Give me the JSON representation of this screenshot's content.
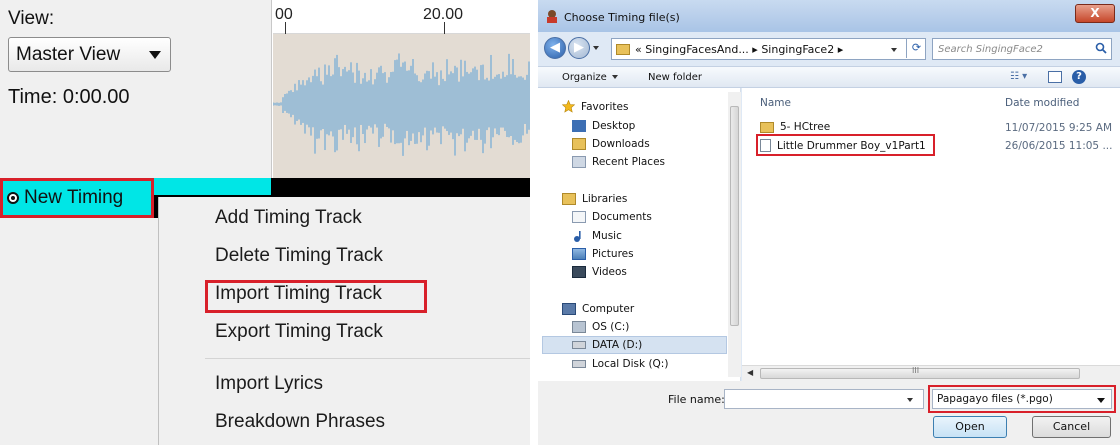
{
  "left_app": {
    "view_label": "View:",
    "view_select_value": "Master View",
    "time_label": "Time: 0:00.00",
    "ruler": {
      "tick_left": "00",
      "tick_right": "20.00"
    },
    "track_name": "New Timing",
    "context_menu": [
      {
        "label": "Add Timing Track"
      },
      {
        "label": "Delete Timing Track"
      },
      {
        "label": "Import Timing Track"
      },
      {
        "label": "Export Timing Track"
      },
      {
        "label": "Import Lyrics"
      },
      {
        "label": "Breakdown Phrases"
      }
    ],
    "highlight_color": "#d8202a",
    "track_color": "#00e6e6",
    "wave_color": "#8cb6d6"
  },
  "dialog": {
    "title": "Choose Timing file(s)",
    "close_label": "X",
    "address_path": "« SingingFacesAnd... ▸ SingingFace2 ▸",
    "search_placeholder": "Search SingingFace2",
    "toolbar": {
      "organize": "Organize",
      "new_folder": "New folder"
    },
    "nav": {
      "favorites": "Favorites",
      "favorites_items": [
        "Desktop",
        "Downloads",
        "Recent Places"
      ],
      "libraries": "Libraries",
      "libraries_items": [
        "Documents",
        "Music",
        "Pictures",
        "Videos"
      ],
      "computer": "Computer",
      "computer_items": [
        "OS (C:)",
        "DATA (D:)",
        "Local Disk (Q:)"
      ]
    },
    "columns": {
      "name": "Name",
      "date": "Date modified"
    },
    "files": [
      {
        "name": "5- HCtree",
        "date": "11/07/2015 9:25 AM",
        "kind": "folder"
      },
      {
        "name": "Little Drummer Boy_v1Part1",
        "date": "26/06/2015 11:05 ...",
        "kind": "file"
      }
    ],
    "file_name_label": "File name:",
    "file_name_value": "",
    "file_type": "Papagayo files (*.pgo)",
    "open_label": "Open",
    "cancel_label": "Cancel"
  }
}
